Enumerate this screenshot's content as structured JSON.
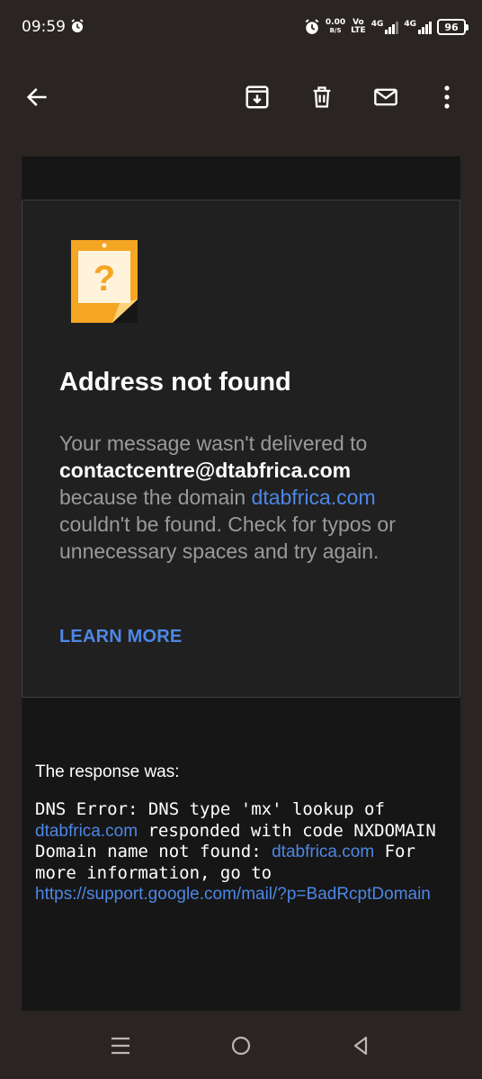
{
  "status": {
    "time": "09:59",
    "net_speed": "0.00",
    "net_unit": "B/S",
    "volte_top": "Vo",
    "volte_bottom": "LTE",
    "sig1_label": "4G",
    "sig2_label": "4G",
    "battery": "96"
  },
  "toolbar": {
    "back_icon": "arrow-left",
    "archive_icon": "archive",
    "delete_icon": "trash",
    "mark_unread_icon": "envelope",
    "more_icon": "more-vertical"
  },
  "card": {
    "title": "Address not found",
    "body_1": "Your message wasn't delivered to",
    "address": "contactcentre@dtabfrica.com",
    "body_2": "because the domain",
    "domain_link": "dtabfrica.com",
    "body_3": "couldn't be found. Check for typos or unnecessary spaces and try again.",
    "learn_more": "LEARN MORE",
    "icon_color": "#f5a623"
  },
  "response": {
    "label": "The response was:",
    "line_1": "DNS Error: DNS type 'mx' lookup of",
    "link_1": "dtabfrica.com",
    "line_2": " responded with code NXDOMAIN Domain name not found: ",
    "link_2": "dtabfrica.com",
    "line_3": " For more information, go to ",
    "link_3": "https://support.google.com/mail/?p=BadRcptDomain"
  },
  "colors": {
    "link": "#4d87e6",
    "bar_bg": "#2a2522",
    "content_bg": "#161616",
    "card_bg": "#202020"
  }
}
